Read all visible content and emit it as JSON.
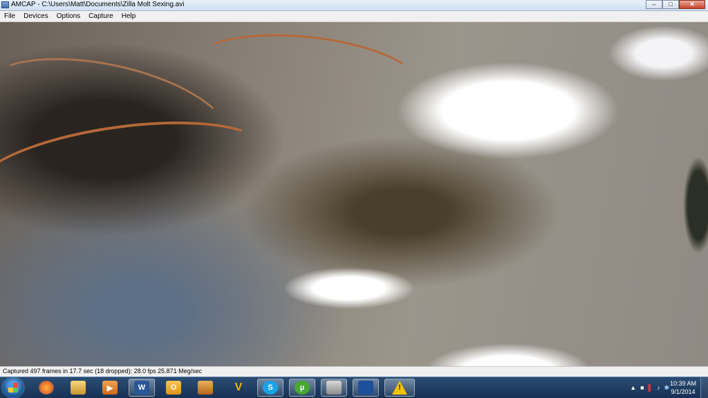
{
  "window": {
    "title": "AMCAP - C:\\Users\\Matt\\Documents\\Zilla Molt Sexing.avi",
    "icon": "amcap-app-icon",
    "controls": {
      "minimize": "–",
      "maximize": "□",
      "close": "✕"
    }
  },
  "menu": [
    "File",
    "Devices",
    "Options",
    "Capture",
    "Help"
  ],
  "statusbar": {
    "text": "Captured 497 frames in 17.7 sec (18 dropped): 28.0 fps 25.871 Meg/sec"
  },
  "taskbar": {
    "pinned": [
      {
        "name": "firefox-icon",
        "glyph": "",
        "color": "#e8722b"
      },
      {
        "name": "file-explorer-icon",
        "glyph": "",
        "color": "#d9b34a"
      },
      {
        "name": "media-player-icon",
        "glyph": "▶",
        "color": "#e0812c"
      },
      {
        "name": "word-icon",
        "glyph": "W",
        "color": "#2a5699"
      },
      {
        "name": "outlook-icon",
        "glyph": "O",
        "color": "#e6a21e"
      },
      {
        "name": "photo-viewer-icon",
        "glyph": "",
        "color": "#c8782a"
      },
      {
        "name": "vectorworks-icon",
        "glyph": "V",
        "color": "#d5a100"
      },
      {
        "name": "skype-icon",
        "glyph": "S",
        "color": "#1aa3e8"
      },
      {
        "name": "utorrent-icon",
        "glyph": "µ",
        "color": "#46a832"
      },
      {
        "name": "amcap-icon",
        "glyph": "",
        "color": "#707070"
      },
      {
        "name": "weather-channel-icon",
        "glyph": "",
        "color": "#1d4f9a"
      },
      {
        "name": "warning-app-icon",
        "glyph": "!",
        "color": "#f2c300"
      }
    ],
    "tray": [
      "▲",
      "■",
      "▌",
      "♪",
      "✱"
    ],
    "clock": {
      "time": "10:39 AM",
      "date": "9/1/2014"
    }
  }
}
